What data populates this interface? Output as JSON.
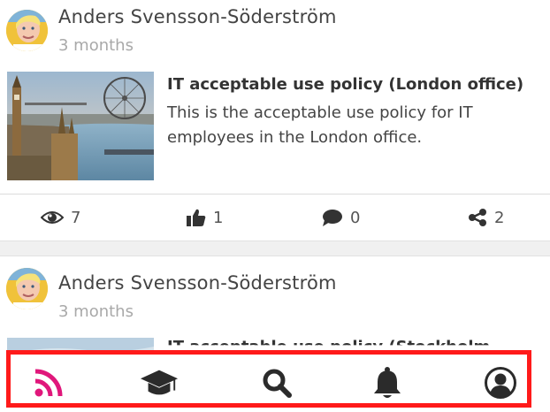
{
  "posts": [
    {
      "author": "Anders Svensson-Söderström",
      "time": "3 months",
      "title": "IT acceptable use policy (London office)",
      "description": "This is the acceptable use policy for IT employees in the London office.",
      "stats": {
        "views": "7",
        "likes": "1",
        "comments": "0",
        "shares": "2"
      }
    },
    {
      "author": "Anders Svensson-Söderström",
      "time": "3 months",
      "title": "IT acceptable use policy (Stockholm"
    }
  ],
  "bottom_nav": {
    "items": [
      {
        "icon": "rss-feed-icon",
        "active": true
      },
      {
        "icon": "graduation-cap-icon",
        "active": false
      },
      {
        "icon": "search-icon",
        "active": false
      },
      {
        "icon": "bell-icon",
        "active": false
      },
      {
        "icon": "user-circle-icon",
        "active": false
      }
    ],
    "active_color": "#e0177b",
    "inactive_color": "#2b2b2b",
    "highlight_border_color": "#ff1a1a"
  }
}
